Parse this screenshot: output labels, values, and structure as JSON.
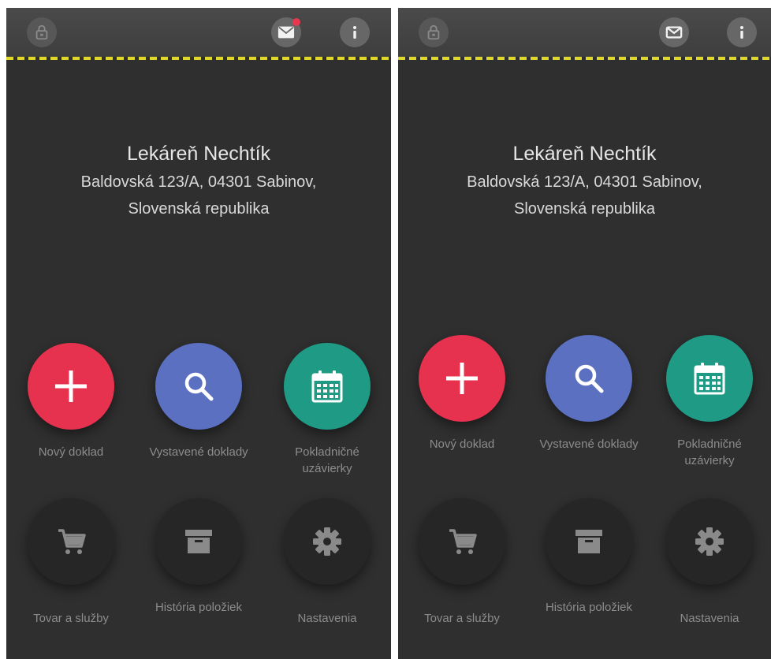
{
  "icons": {
    "lock": "lock-icon",
    "mail": "mail-icon",
    "info": "info-icon",
    "add": "plus-icon",
    "search": "search-icon",
    "calendar": "calendar-icon",
    "cart": "cart-icon",
    "archive": "archive-box-icon",
    "settings": "gear-icon"
  },
  "colors": {
    "accent_red": "#e7324f",
    "accent_blue": "#5b70c1",
    "accent_green": "#1f9a85",
    "topbar_stripe": "#e0d72c",
    "background": "#2f2f2f"
  },
  "screens": [
    {
      "has_unread_badge": true,
      "header": {
        "title": "Lekáreň Nechtík",
        "address_line1": "Baldovská 123/A, 04301 Sabinov,",
        "address_line2": "Slovenská republika"
      },
      "tiles": {
        "new_doc": "Nový doklad",
        "issued_docs": "Vystavené doklady",
        "closings": "Pokladničné uzávierky",
        "goods": "Tovar a služby",
        "history": "História položiek",
        "settings": "Nastavenia"
      }
    },
    {
      "has_unread_badge": false,
      "header": {
        "title": "Lekáreň Nechtík",
        "address_line1": "Baldovská 123/A, 04301 Sabinov,",
        "address_line2": "Slovenská republika"
      },
      "tiles": {
        "new_doc": "Nový doklad",
        "issued_docs": "Vystavené doklady",
        "closings": "Pokladničné uzávierky",
        "goods": "Tovar a služby",
        "history": "História položiek",
        "settings": "Nastavenia"
      }
    }
  ]
}
